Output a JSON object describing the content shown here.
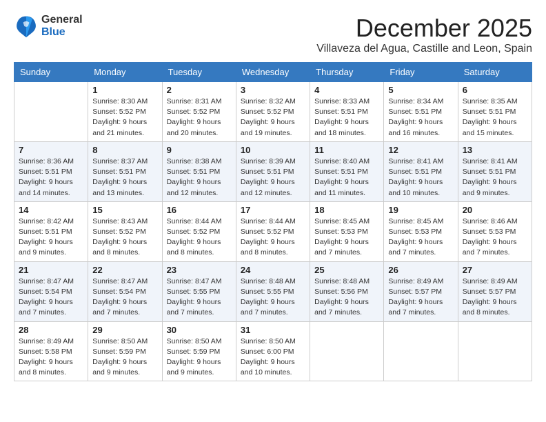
{
  "logo": {
    "general": "General",
    "blue": "Blue"
  },
  "title": "December 2025",
  "location": "Villaveza del Agua, Castille and Leon, Spain",
  "days_of_week": [
    "Sunday",
    "Monday",
    "Tuesday",
    "Wednesday",
    "Thursday",
    "Friday",
    "Saturday"
  ],
  "weeks": [
    [
      {
        "day": "",
        "info": ""
      },
      {
        "day": "1",
        "info": "Sunrise: 8:30 AM\nSunset: 5:52 PM\nDaylight: 9 hours\nand 21 minutes."
      },
      {
        "day": "2",
        "info": "Sunrise: 8:31 AM\nSunset: 5:52 PM\nDaylight: 9 hours\nand 20 minutes."
      },
      {
        "day": "3",
        "info": "Sunrise: 8:32 AM\nSunset: 5:52 PM\nDaylight: 9 hours\nand 19 minutes."
      },
      {
        "day": "4",
        "info": "Sunrise: 8:33 AM\nSunset: 5:51 PM\nDaylight: 9 hours\nand 18 minutes."
      },
      {
        "day": "5",
        "info": "Sunrise: 8:34 AM\nSunset: 5:51 PM\nDaylight: 9 hours\nand 16 minutes."
      },
      {
        "day": "6",
        "info": "Sunrise: 8:35 AM\nSunset: 5:51 PM\nDaylight: 9 hours\nand 15 minutes."
      }
    ],
    [
      {
        "day": "7",
        "info": "Sunrise: 8:36 AM\nSunset: 5:51 PM\nDaylight: 9 hours\nand 14 minutes."
      },
      {
        "day": "8",
        "info": "Sunrise: 8:37 AM\nSunset: 5:51 PM\nDaylight: 9 hours\nand 13 minutes."
      },
      {
        "day": "9",
        "info": "Sunrise: 8:38 AM\nSunset: 5:51 PM\nDaylight: 9 hours\nand 12 minutes."
      },
      {
        "day": "10",
        "info": "Sunrise: 8:39 AM\nSunset: 5:51 PM\nDaylight: 9 hours\nand 12 minutes."
      },
      {
        "day": "11",
        "info": "Sunrise: 8:40 AM\nSunset: 5:51 PM\nDaylight: 9 hours\nand 11 minutes."
      },
      {
        "day": "12",
        "info": "Sunrise: 8:41 AM\nSunset: 5:51 PM\nDaylight: 9 hours\nand 10 minutes."
      },
      {
        "day": "13",
        "info": "Sunrise: 8:41 AM\nSunset: 5:51 PM\nDaylight: 9 hours\nand 9 minutes."
      }
    ],
    [
      {
        "day": "14",
        "info": "Sunrise: 8:42 AM\nSunset: 5:51 PM\nDaylight: 9 hours\nand 9 minutes."
      },
      {
        "day": "15",
        "info": "Sunrise: 8:43 AM\nSunset: 5:52 PM\nDaylight: 9 hours\nand 8 minutes."
      },
      {
        "day": "16",
        "info": "Sunrise: 8:44 AM\nSunset: 5:52 PM\nDaylight: 9 hours\nand 8 minutes."
      },
      {
        "day": "17",
        "info": "Sunrise: 8:44 AM\nSunset: 5:52 PM\nDaylight: 9 hours\nand 8 minutes."
      },
      {
        "day": "18",
        "info": "Sunrise: 8:45 AM\nSunset: 5:53 PM\nDaylight: 9 hours\nand 7 minutes."
      },
      {
        "day": "19",
        "info": "Sunrise: 8:45 AM\nSunset: 5:53 PM\nDaylight: 9 hours\nand 7 minutes."
      },
      {
        "day": "20",
        "info": "Sunrise: 8:46 AM\nSunset: 5:53 PM\nDaylight: 9 hours\nand 7 minutes."
      }
    ],
    [
      {
        "day": "21",
        "info": "Sunrise: 8:47 AM\nSunset: 5:54 PM\nDaylight: 9 hours\nand 7 minutes."
      },
      {
        "day": "22",
        "info": "Sunrise: 8:47 AM\nSunset: 5:54 PM\nDaylight: 9 hours\nand 7 minutes."
      },
      {
        "day": "23",
        "info": "Sunrise: 8:47 AM\nSunset: 5:55 PM\nDaylight: 9 hours\nand 7 minutes."
      },
      {
        "day": "24",
        "info": "Sunrise: 8:48 AM\nSunset: 5:55 PM\nDaylight: 9 hours\nand 7 minutes."
      },
      {
        "day": "25",
        "info": "Sunrise: 8:48 AM\nSunset: 5:56 PM\nDaylight: 9 hours\nand 7 minutes."
      },
      {
        "day": "26",
        "info": "Sunrise: 8:49 AM\nSunset: 5:57 PM\nDaylight: 9 hours\nand 7 minutes."
      },
      {
        "day": "27",
        "info": "Sunrise: 8:49 AM\nSunset: 5:57 PM\nDaylight: 9 hours\nand 8 minutes."
      }
    ],
    [
      {
        "day": "28",
        "info": "Sunrise: 8:49 AM\nSunset: 5:58 PM\nDaylight: 9 hours\nand 8 minutes."
      },
      {
        "day": "29",
        "info": "Sunrise: 8:50 AM\nSunset: 5:59 PM\nDaylight: 9 hours\nand 9 minutes."
      },
      {
        "day": "30",
        "info": "Sunrise: 8:50 AM\nSunset: 5:59 PM\nDaylight: 9 hours\nand 9 minutes."
      },
      {
        "day": "31",
        "info": "Sunrise: 8:50 AM\nSunset: 6:00 PM\nDaylight: 9 hours\nand 10 minutes."
      },
      {
        "day": "",
        "info": ""
      },
      {
        "day": "",
        "info": ""
      },
      {
        "day": "",
        "info": ""
      }
    ]
  ]
}
